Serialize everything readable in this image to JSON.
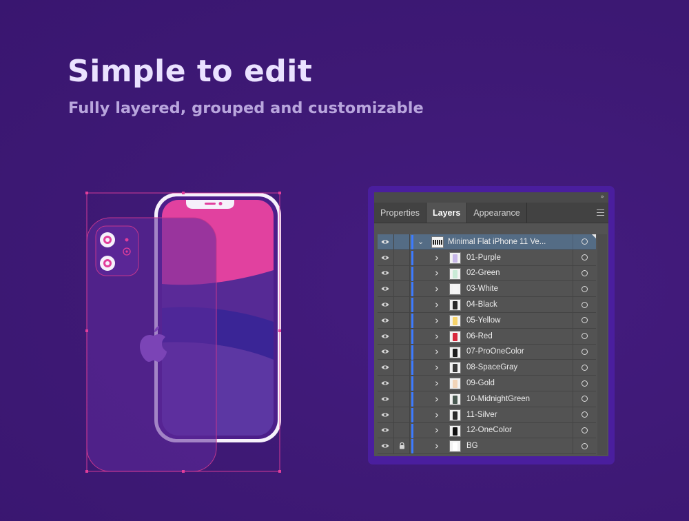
{
  "hero": {
    "title": "Simple to edit",
    "subtitle": "Fully layered, grouped and customizable"
  },
  "panel": {
    "collapse_icon": "double-chevron-right-icon",
    "collapse_glyph": "»",
    "tabs": [
      {
        "label": "Properties",
        "active": false
      },
      {
        "label": "Layers",
        "active": true
      },
      {
        "label": "Appearance",
        "active": false
      }
    ],
    "menu_icon": "hamburger-menu-icon",
    "top_layer": {
      "name": "Minimal Flat iPhone 11 Ve...",
      "expanded": true
    },
    "layers": [
      {
        "name": "01-Purple",
        "swatch": "#c7b7e8",
        "locked": false
      },
      {
        "name": "02-Green",
        "swatch": "#c9ead6",
        "locked": false
      },
      {
        "name": "03-White",
        "swatch": "#f4f4f4",
        "locked": false
      },
      {
        "name": "04-Black",
        "swatch": "#2a2a2a",
        "locked": false
      },
      {
        "name": "05-Yellow",
        "swatch": "#f6d36a",
        "locked": false
      },
      {
        "name": "06-Red",
        "swatch": "#d8283d",
        "locked": false
      },
      {
        "name": "07-ProOneColor",
        "swatch": "#1d1d1d",
        "locked": false
      },
      {
        "name": "08-SpaceGray",
        "swatch": "#3a3a3a",
        "locked": false
      },
      {
        "name": "09-Gold",
        "swatch": "#f1d4b8",
        "locked": false
      },
      {
        "name": "10-MidnightGreen",
        "swatch": "#4a5a52",
        "locked": false
      },
      {
        "name": "11-Silver",
        "swatch": "#2b2b2b",
        "locked": false
      },
      {
        "name": "12-OneColor",
        "swatch": "#111111",
        "locked": false
      },
      {
        "name": "BG",
        "swatch": "#ffffff",
        "locked": true
      }
    ]
  },
  "colors": {
    "background": "#3e1975",
    "accent_pink": "#e23e9b",
    "selection_blue": "#3d7bff",
    "panel_frame": "#4a1e9e"
  }
}
